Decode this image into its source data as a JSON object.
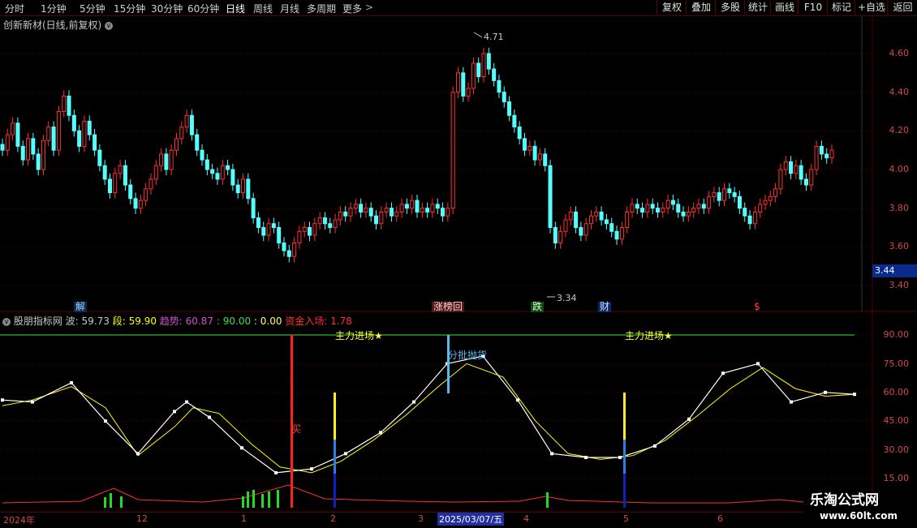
{
  "toolbar": {
    "periods": [
      "分时",
      "1分钟",
      "5分钟",
      "15分钟",
      "30分钟",
      "60分钟",
      "日线",
      "周线",
      "月线",
      "多周期",
      "更多"
    ],
    "active_period": "日线",
    "buttons": [
      "复权",
      "叠加",
      "多股",
      "统计",
      "画线",
      "F10",
      "标记",
      "+自选",
      "返回"
    ]
  },
  "main_chart": {
    "title": "创新新材(日线,前复权)",
    "price_axis": [
      "4.60",
      "4.40",
      "4.20",
      "4.00",
      "3.80",
      "3.60",
      "3.40"
    ],
    "current_price": "3.44",
    "high_label": "4.71",
    "low_label": "3.34",
    "event_tags": [
      "解",
      "涨榜回",
      "跌",
      "财",
      "$"
    ],
    "colors": {
      "up": "#ff3030",
      "down": "#54ffff",
      "axis_text": "#d24a4a",
      "grid": "#5a0000"
    }
  },
  "indicator": {
    "name": "股朋指标网",
    "readouts": [
      {
        "label": "波:",
        "value": "59.73",
        "color": "#c8c8c8"
      },
      {
        "label": "段:",
        "value": "59.90",
        "color": "#ffff00"
      },
      {
        "label": "趋势:",
        "value": "60.87",
        "color": "#d050d0"
      },
      {
        "label": ":",
        "value": "90.00",
        "color": "#44dd44"
      },
      {
        "label": ":",
        "value": "0.00",
        "color": "#ffff60"
      },
      {
        "label": "资金入场:",
        "value": "1.78",
        "color": "#ff3030"
      }
    ],
    "axis": [
      "90.00",
      "75.00",
      "60.00",
      "45.00",
      "30.00",
      "15.00"
    ],
    "annotations": [
      "主力进场★",
      "主力进场★",
      "买",
      "分批抛货"
    ]
  },
  "date_axis": {
    "labels": [
      "2024年",
      "12",
      "1",
      "2",
      "3",
      "2025/03/07/五",
      "4",
      "5",
      "6"
    ]
  },
  "watermark": {
    "line1": "乐淘公式网",
    "line2": "www.60lt.com"
  }
}
